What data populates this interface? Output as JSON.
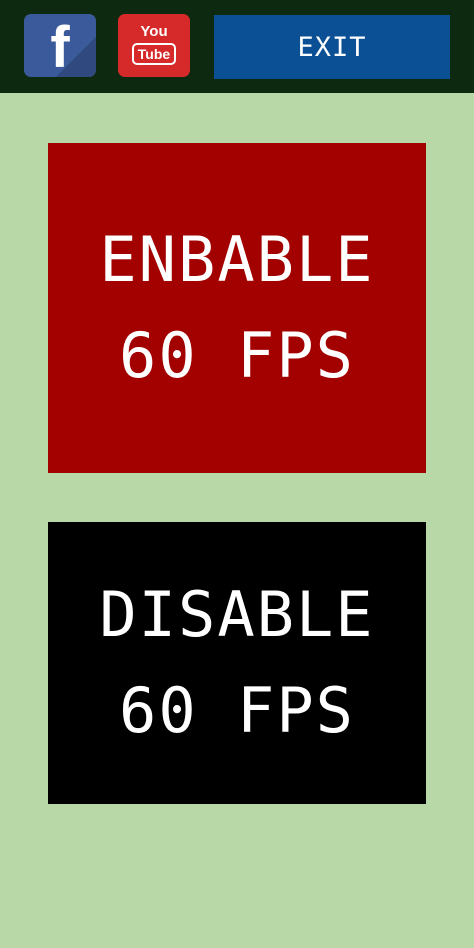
{
  "header": {
    "facebook": {
      "icon": "facebook-icon",
      "letter": "f",
      "color": "#3b5a9c"
    },
    "youtube": {
      "icon": "youtube-icon",
      "you": "You",
      "tube": "Tube",
      "color": "#d62a2a"
    },
    "exit_label": "EXIT"
  },
  "main": {
    "enable": {
      "line1": "ENBABLE",
      "line2": "60 FPS",
      "color": "#a30000"
    },
    "disable": {
      "line1": "DISABLE",
      "line2": "60 FPS",
      "color": "#000000"
    }
  }
}
